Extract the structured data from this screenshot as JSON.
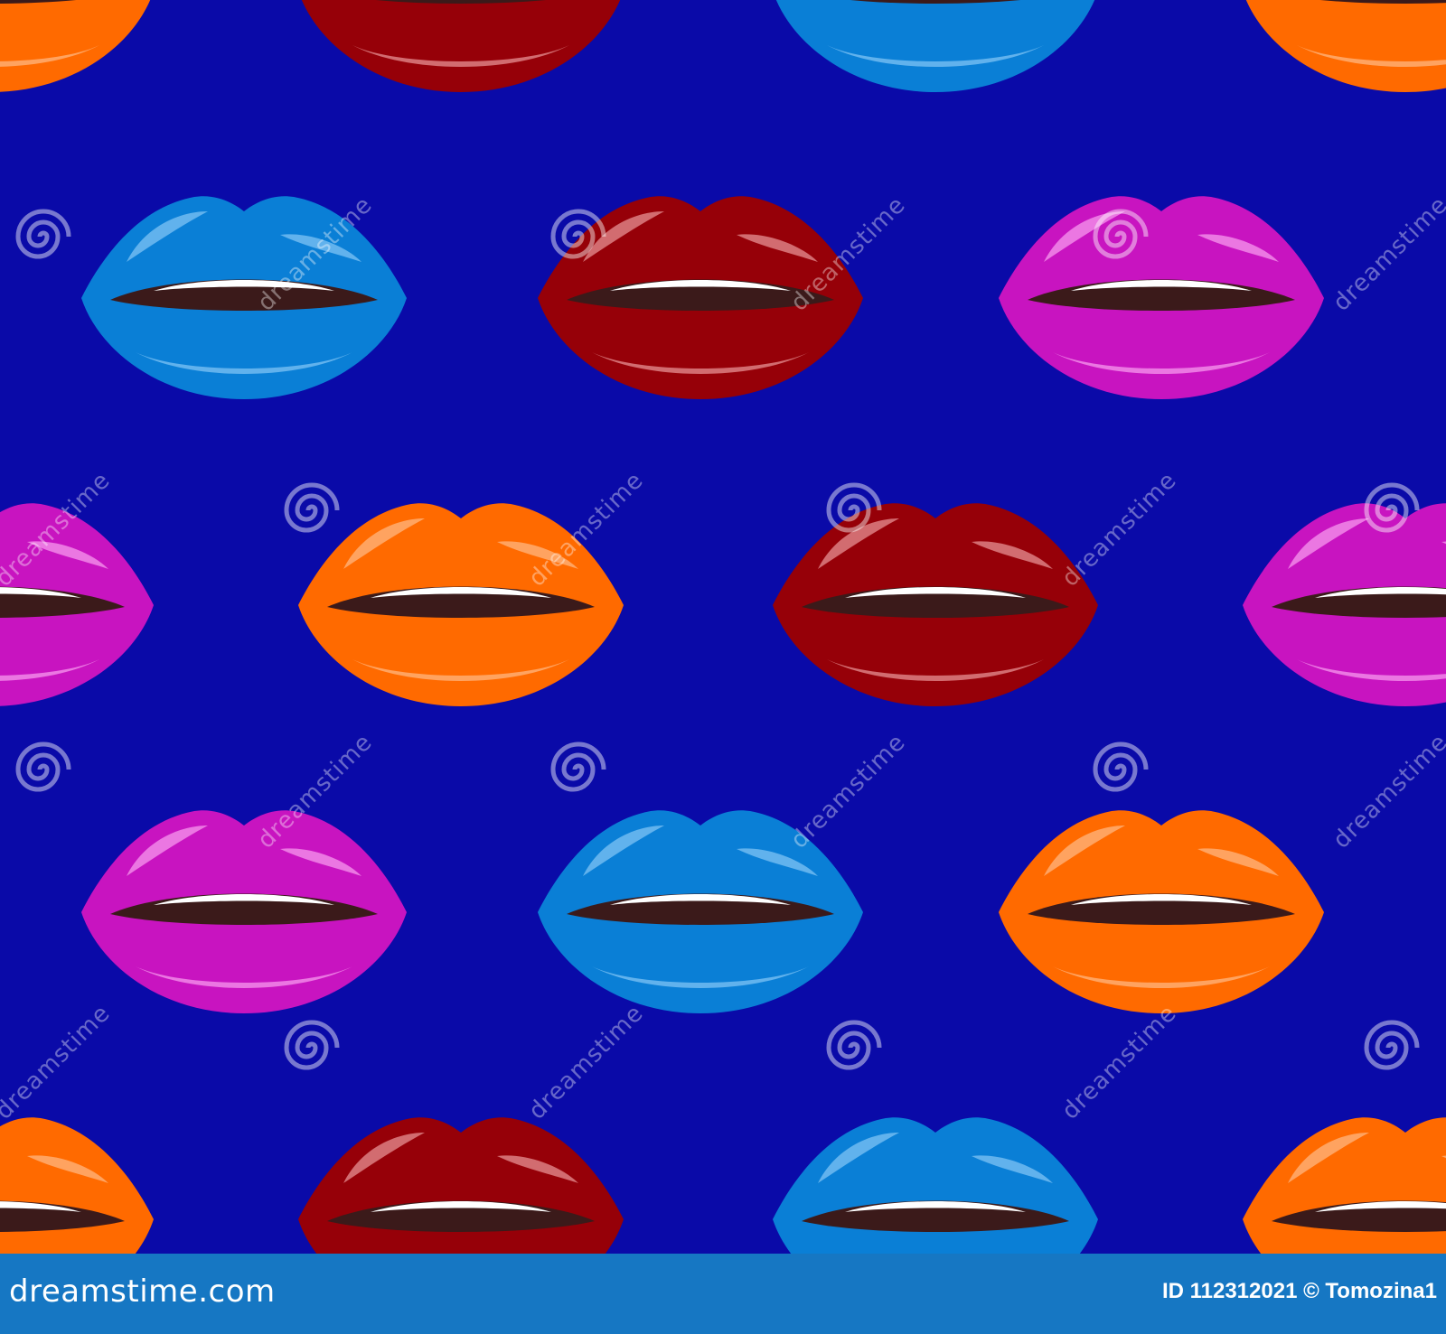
{
  "colors": {
    "background": "#0a0aa8",
    "footer": "#1677c3",
    "mouth": "#3b1a1a",
    "teeth": "#ffffff"
  },
  "palette": {
    "orange": {
      "base": "#ff6a00",
      "hi": "#ffaa6a"
    },
    "red": {
      "base": "#960008",
      "hi": "#d8787c"
    },
    "blue": {
      "base": "#0a7fd6",
      "hi": "#6ab8f0"
    },
    "pink": {
      "base": "#c814c0",
      "hi": "#ee82e6"
    }
  },
  "lips": {
    "row0": [
      "orange",
      "red",
      "blue",
      "orange"
    ],
    "row1": [
      "blue",
      "red",
      "pink"
    ],
    "row2": [
      "pink",
      "orange",
      "red",
      "pink"
    ],
    "row3": [
      "pink",
      "blue",
      "orange"
    ],
    "row4": [
      "orange",
      "red",
      "blue",
      "orange"
    ]
  },
  "watermark": {
    "text": "dreamstime",
    "spiral_icon": "spiral-icon"
  },
  "footer": {
    "logo": "dreamstime.com",
    "credit": "ID 112312021 © Tomozina1"
  }
}
